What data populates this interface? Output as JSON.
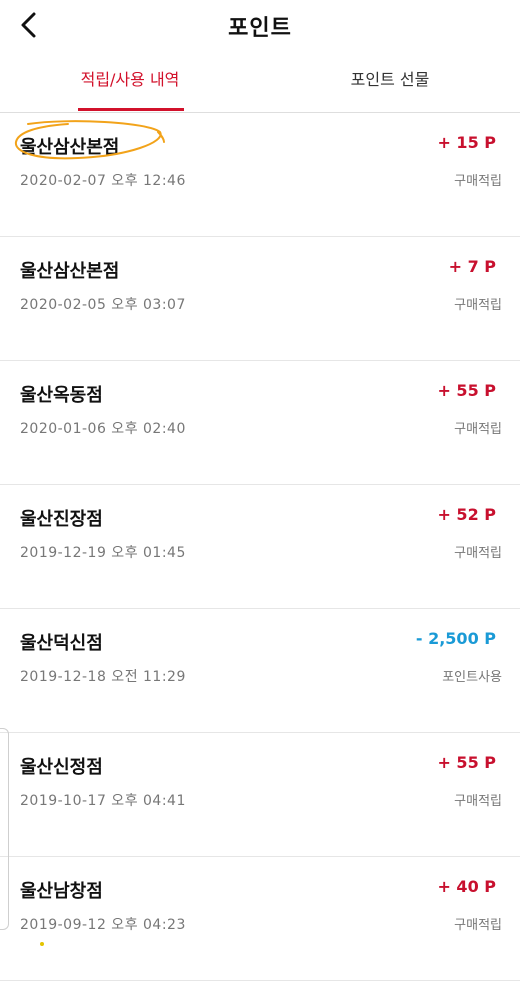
{
  "header": {
    "title": "포인트",
    "back_icon": "chevron-left-icon"
  },
  "tabs": [
    {
      "label": "적립/사용 내역",
      "active": true
    },
    {
      "label": "포인트 선물",
      "active": false
    }
  ],
  "colors": {
    "accent": "#d2112b",
    "plus": "#c8102e",
    "minus": "#1a9ad6",
    "highlight": "#f2a31a"
  },
  "items": [
    {
      "store": "울산삼산본점",
      "date": "2020-02-07 오후 12:46",
      "amount": "+ 15 P",
      "type": "구매적립",
      "sign": "plus"
    },
    {
      "store": "울산삼산본점",
      "date": "2020-02-05 오후 03:07",
      "amount": "+ 7 P",
      "type": "구매적립",
      "sign": "plus"
    },
    {
      "store": "울산옥동점",
      "date": "2020-01-06 오후 02:40",
      "amount": "+ 55 P",
      "type": "구매적립",
      "sign": "plus"
    },
    {
      "store": "울산진장점",
      "date": "2019-12-19 오후 01:45",
      "amount": "+ 52 P",
      "type": "구매적립",
      "sign": "plus"
    },
    {
      "store": "울산덕신점",
      "date": "2019-12-18 오전 11:29",
      "amount": "- 2,500 P",
      "type": "포인트사용",
      "sign": "minus"
    },
    {
      "store": "울산신정점",
      "date": "2019-10-17 오후 04:41",
      "amount": "+ 55 P",
      "type": "구매적립",
      "sign": "plus"
    },
    {
      "store": "울산남창점",
      "date": "2019-09-12 오후 04:23",
      "amount": "+ 40 P",
      "type": "구매적립",
      "sign": "plus"
    }
  ]
}
